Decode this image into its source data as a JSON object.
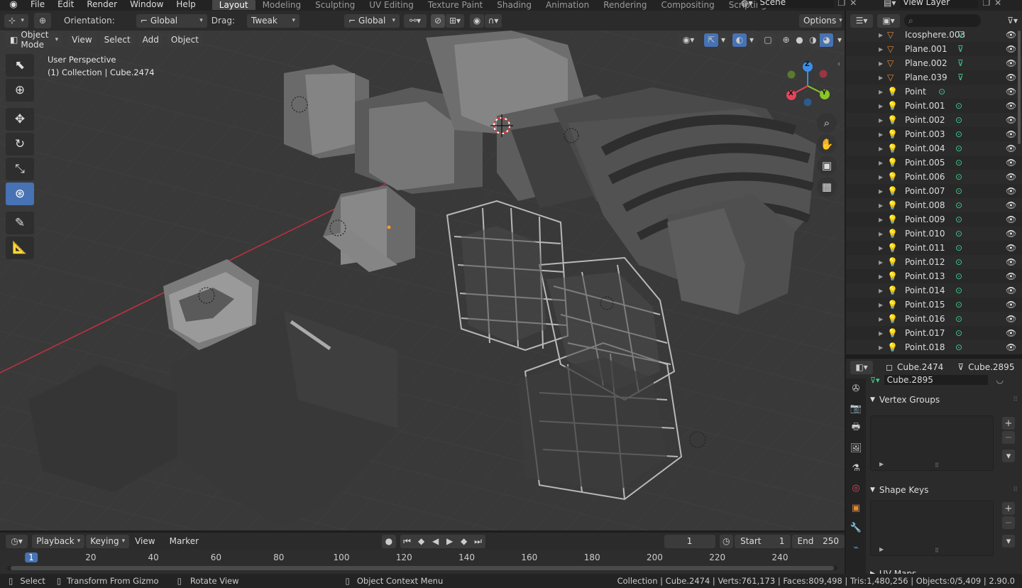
{
  "menubar": {
    "menus": [
      "File",
      "Edit",
      "Render",
      "Window",
      "Help"
    ],
    "workspaces": [
      "Layout",
      "Modeling",
      "Sculpting",
      "UV Editing",
      "Texture Paint",
      "Shading",
      "Animation",
      "Rendering",
      "Compositing",
      "Scripting"
    ],
    "active_workspace": "Layout",
    "scene": "Scene",
    "view_layer": "View Layer"
  },
  "tool_header": {
    "orientation_label": "Orientation:",
    "orientation_value": "Global",
    "drag_label": "Drag:",
    "drag_value": "Tweak",
    "transform_orientation": "Global",
    "options": "Options"
  },
  "viewport_header": {
    "mode": "Object Mode",
    "menus": [
      "View",
      "Select",
      "Add",
      "Object"
    ]
  },
  "viewport": {
    "perspective": "User Perspective",
    "collection_info": "(1) Collection | Cube.2474",
    "axis_x": "X",
    "axis_y": "Y",
    "axis_z": "Z"
  },
  "outliner": {
    "items": [
      {
        "name": "Icosphere.003",
        "type": "mesh"
      },
      {
        "name": "Plane.001",
        "type": "mesh"
      },
      {
        "name": "Plane.002",
        "type": "mesh"
      },
      {
        "name": "Plane.039",
        "type": "mesh"
      },
      {
        "name": "Point",
        "type": "light"
      },
      {
        "name": "Point.001",
        "type": "light"
      },
      {
        "name": "Point.002",
        "type": "light"
      },
      {
        "name": "Point.003",
        "type": "light"
      },
      {
        "name": "Point.004",
        "type": "light"
      },
      {
        "name": "Point.005",
        "type": "light"
      },
      {
        "name": "Point.006",
        "type": "light"
      },
      {
        "name": "Point.007",
        "type": "light"
      },
      {
        "name": "Point.008",
        "type": "light"
      },
      {
        "name": "Point.009",
        "type": "light"
      },
      {
        "name": "Point.010",
        "type": "light"
      },
      {
        "name": "Point.011",
        "type": "light"
      },
      {
        "name": "Point.012",
        "type": "light"
      },
      {
        "name": "Point.013",
        "type": "light"
      },
      {
        "name": "Point.014",
        "type": "light"
      },
      {
        "name": "Point.015",
        "type": "light"
      },
      {
        "name": "Point.016",
        "type": "light"
      },
      {
        "name": "Point.017",
        "type": "light"
      },
      {
        "name": "Point.018",
        "type": "light"
      }
    ]
  },
  "properties": {
    "object_name": "Cube.2474",
    "mesh_name": "Cube.2895",
    "datablock": "Cube.2895",
    "panels": [
      "Vertex Groups",
      "Shape Keys",
      "UV Maps"
    ]
  },
  "timeline": {
    "menus": [
      "Playback",
      "Keying",
      "View",
      "Marker"
    ],
    "current_frame": "1",
    "start_label": "Start",
    "start_value": "1",
    "end_label": "End",
    "end_value": "250",
    "ticks": [
      "1",
      "20",
      "40",
      "60",
      "80",
      "100",
      "120",
      "140",
      "160",
      "180",
      "200",
      "220",
      "240"
    ]
  },
  "statusbar": {
    "select": "Select",
    "transform": "Transform From Gizmo",
    "rotate": "Rotate View",
    "context_menu": "Object Context Menu",
    "stats": "Collection | Cube.2474 | Verts:761,173 | Faces:809,498 | Tris:1,480,256 | Objects:0/5,409 | 2.90.0"
  },
  "colors": {
    "accent": "#4772b3",
    "mesh_icon": "#e0883a",
    "data_icon": "#3fcf8e",
    "axis_x": "#e2455b",
    "axis_y": "#8ac427",
    "axis_z": "#3a8ee6"
  }
}
